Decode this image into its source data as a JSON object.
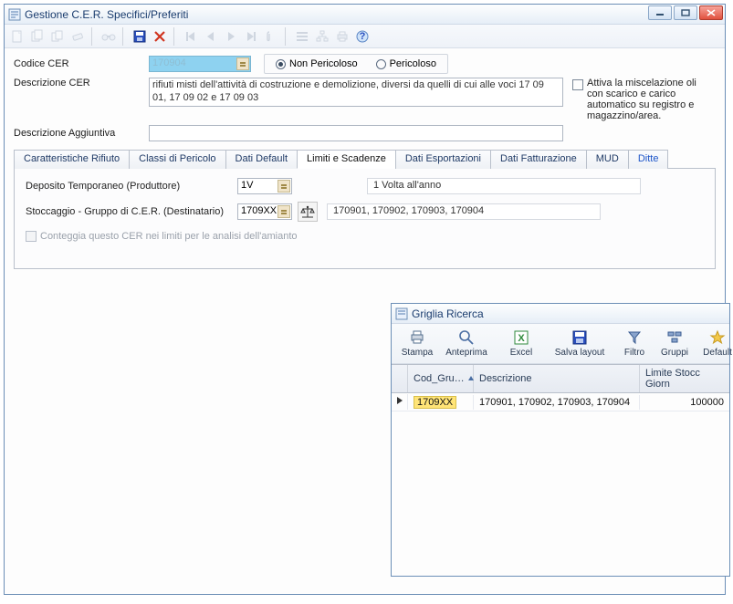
{
  "window": {
    "title": "Gestione C.E.R. Specifici/Preferiti"
  },
  "form": {
    "codice_cer_label": "Codice CER",
    "codice_cer_value": "170904",
    "radio_non_pericoloso": "Non Pericoloso",
    "radio_pericoloso": "Pericoloso",
    "descrizione_cer_label": "Descrizione CER",
    "descrizione_cer_value": "rifiuti misti dell'attività di costruzione e demolizione, diversi da quelli di cui alle voci 17 09 01, 17 09 02 e 17 09 03",
    "descrizione_agg_label": "Descrizione Aggiuntiva",
    "descrizione_agg_value": "",
    "oil_mix_label": "Attiva la miscelazione oli con scarico e carico automatico su registro e magazzino/area."
  },
  "tabs": {
    "t1": "Caratteristiche Rifiuto",
    "t2": "Classi di Pericolo",
    "t3": "Dati Default",
    "t4": "Limiti e Scadenze",
    "t5": "Dati Esportazioni",
    "t6": "Dati Fatturazione",
    "t7": "MUD",
    "t8": "Ditte"
  },
  "limiti": {
    "deposito_label": "Deposito Temporaneo (Produttore)",
    "deposito_value": "1V",
    "deposito_desc": "1 Volta all'anno",
    "stoccaggio_label": "Stoccaggio - Gruppo di C.E.R. (Destinatario)",
    "stoccaggio_value": "1709XX",
    "stoccaggio_desc": "170901, 170902, 170903, 170904",
    "amianto_check": "Conteggia questo CER nei limiti per le analisi dell'amianto"
  },
  "dlg": {
    "title": "Griglia Ricerca",
    "toolbar": {
      "stampa": "Stampa",
      "anteprima": "Anteprima",
      "excel": "Excel",
      "salva_layout": "Salva layout",
      "filtro": "Filtro",
      "gruppi": "Gruppi",
      "default": "Default"
    },
    "grid": {
      "headers": {
        "cod_gru": "Cod_Gru…",
        "descrizione": "Descrizione",
        "limite": "Limite Stocc Giorn"
      },
      "rows": [
        {
          "cod_gru": "1709XX",
          "descrizione": "170901, 170902, 170903, 170904",
          "limite": "100000"
        }
      ]
    }
  }
}
